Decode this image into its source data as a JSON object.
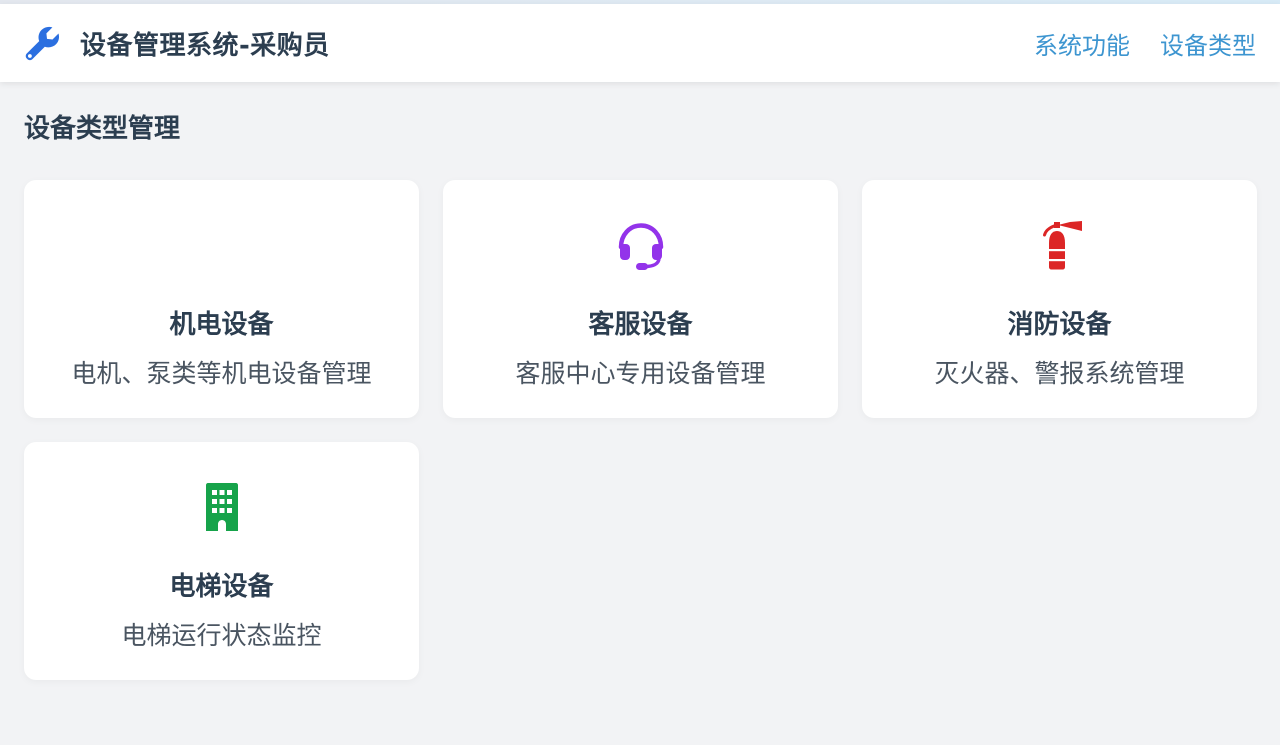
{
  "header": {
    "title": "设备管理系统-采购员",
    "logo_icon": "wrench-icon",
    "nav": [
      {
        "label": "系统功能"
      },
      {
        "label": "设备类型"
      }
    ]
  },
  "page": {
    "title": "设备类型管理"
  },
  "colors": {
    "accent": "#3d95d0",
    "logo": "#2b6fe0",
    "headset": "#9333ea",
    "extinguisher": "#dc2626",
    "building": "#16a34a"
  },
  "cards": [
    {
      "name": "机电设备",
      "desc": "电机、泵类等机电设备管理",
      "icon": "none"
    },
    {
      "name": "客服设备",
      "desc": "客服中心专用设备管理",
      "icon": "headset-icon"
    },
    {
      "name": "消防设备",
      "desc": "灭火器、警报系统管理",
      "icon": "fire-extinguisher-icon"
    },
    {
      "name": "电梯设备",
      "desc": "电梯运行状态监控",
      "icon": "building-icon"
    }
  ]
}
